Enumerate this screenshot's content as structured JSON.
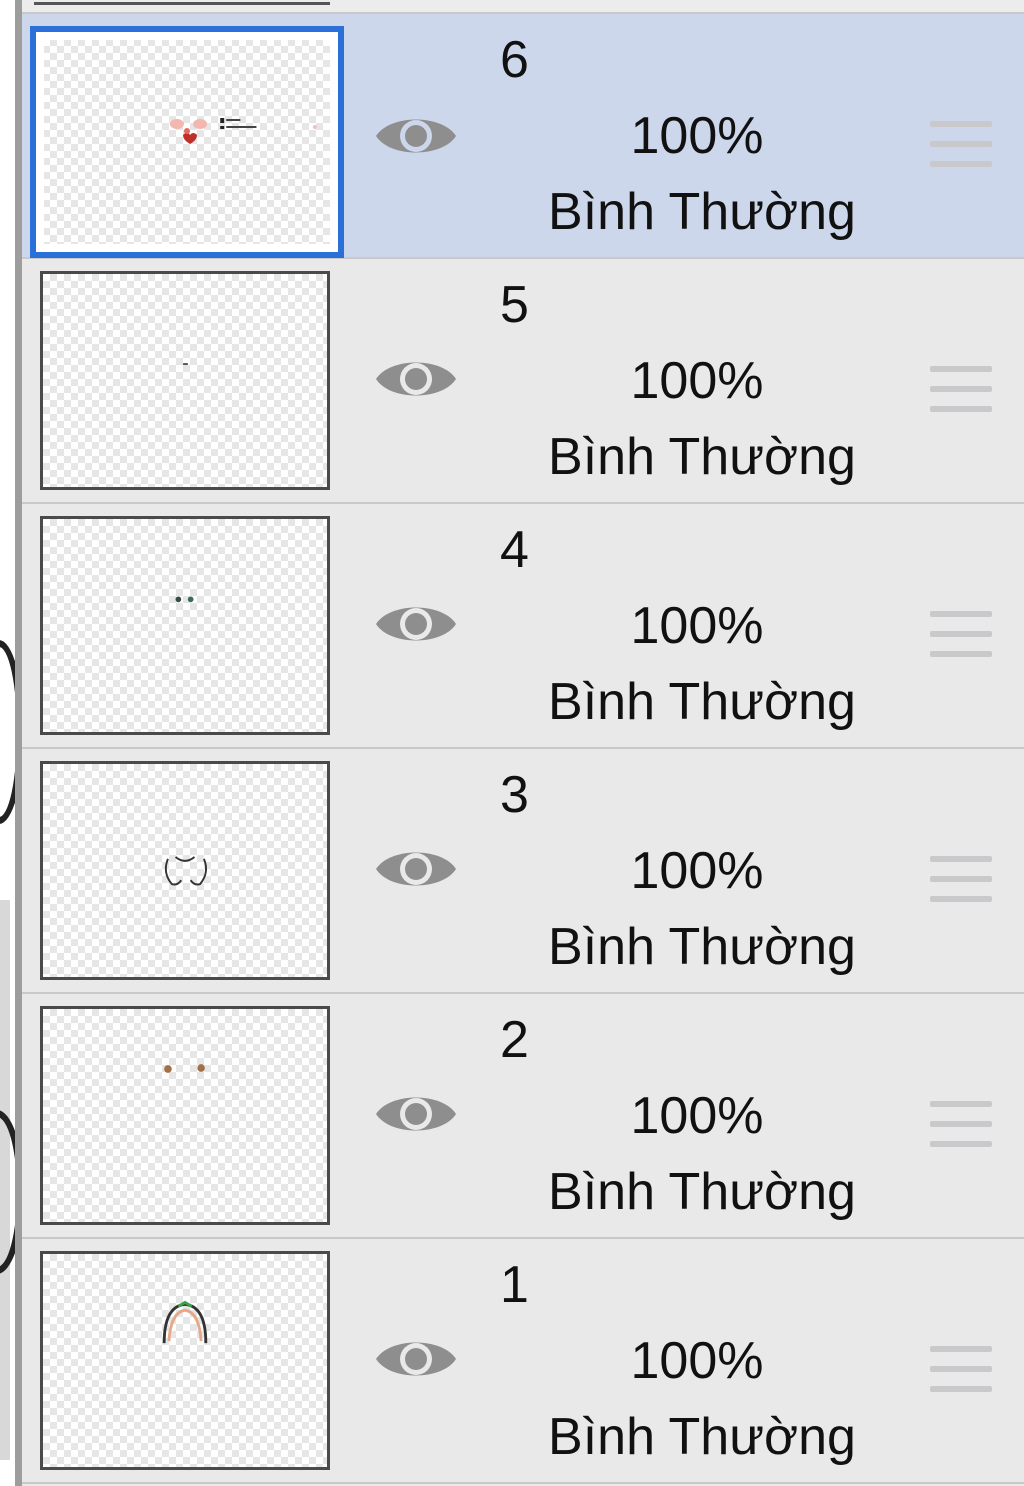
{
  "panel": {
    "accent_color": "#2b6fd8",
    "selected_row_color": "#cdd7eb",
    "layers": [
      {
        "name": "6",
        "opacity": "100%",
        "blend_mode": "Bình Thường",
        "visible": true,
        "selected": true,
        "visibility_icon": "eye-icon",
        "drag_icon": "drag-handle-icon"
      },
      {
        "name": "5",
        "opacity": "100%",
        "blend_mode": "Bình Thường",
        "visible": true,
        "selected": false,
        "visibility_icon": "eye-icon",
        "drag_icon": "drag-handle-icon"
      },
      {
        "name": "4",
        "opacity": "100%",
        "blend_mode": "Bình Thường",
        "visible": true,
        "selected": false,
        "visibility_icon": "eye-icon",
        "drag_icon": "drag-handle-icon"
      },
      {
        "name": "3",
        "opacity": "100%",
        "blend_mode": "Bình Thường",
        "visible": true,
        "selected": false,
        "visibility_icon": "eye-icon",
        "drag_icon": "drag-handle-icon"
      },
      {
        "name": "2",
        "opacity": "100%",
        "blend_mode": "Bình Thường",
        "visible": true,
        "selected": false,
        "visibility_icon": "eye-icon",
        "drag_icon": "drag-handle-icon"
      },
      {
        "name": "1",
        "opacity": "100%",
        "blend_mode": "Bình Thường",
        "visible": true,
        "selected": false,
        "visibility_icon": "eye-icon",
        "drag_icon": "drag-handle-icon"
      }
    ]
  }
}
